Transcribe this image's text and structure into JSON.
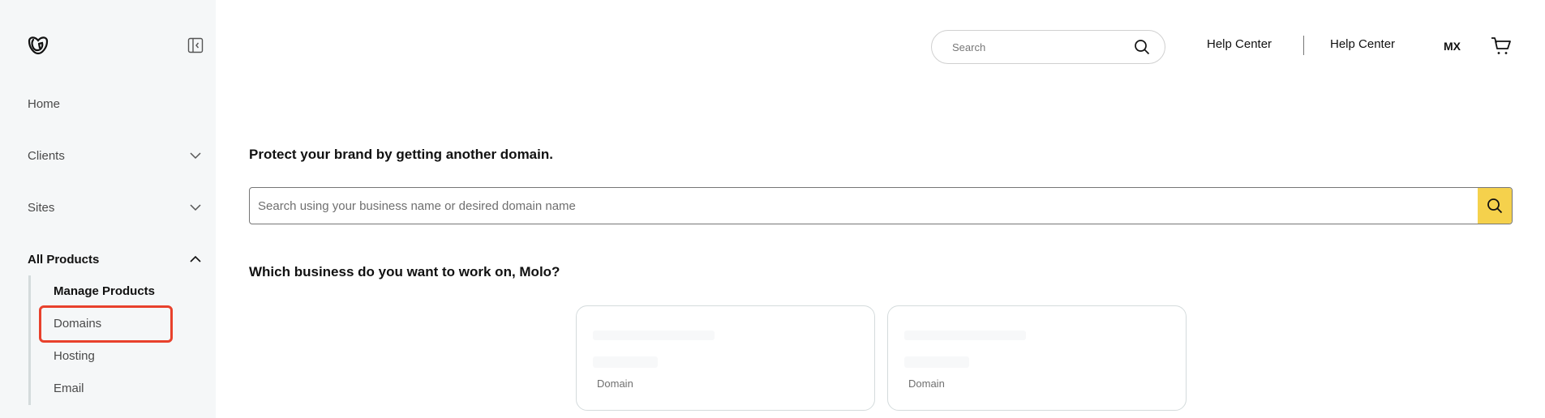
{
  "sidebar": {
    "logo": "godaddy-logo",
    "collapse_icon": "sidebar-collapse-icon",
    "items": [
      {
        "label": "Home",
        "expandable": false
      },
      {
        "label": "Clients",
        "expandable": true,
        "expanded": false
      },
      {
        "label": "Sites",
        "expandable": true,
        "expanded": false
      },
      {
        "label": "All Products",
        "expandable": true,
        "expanded": true
      }
    ],
    "sub_items": [
      {
        "label": "Manage Products"
      },
      {
        "label": "Domains",
        "highlighted": true
      },
      {
        "label": "Hosting"
      },
      {
        "label": "Email"
      }
    ]
  },
  "header": {
    "search": {
      "placeholder": "Search",
      "value": ""
    },
    "links": [
      "Help Center",
      "Help Center"
    ],
    "locale": "MX",
    "cart_icon": "cart-icon"
  },
  "main": {
    "protect_heading": "Protect your brand by getting another domain.",
    "domain_search": {
      "placeholder": "Search using your business name or desired domain name",
      "value": ""
    },
    "business_heading": "Which business do you want to work on, Molo?",
    "cards": [
      {
        "type": "Domain"
      },
      {
        "type": "Domain"
      }
    ]
  },
  "colors": {
    "sidebar_bg": "#f5f7f8",
    "search_button": "#f5d14c",
    "highlight": "#e8412c"
  }
}
